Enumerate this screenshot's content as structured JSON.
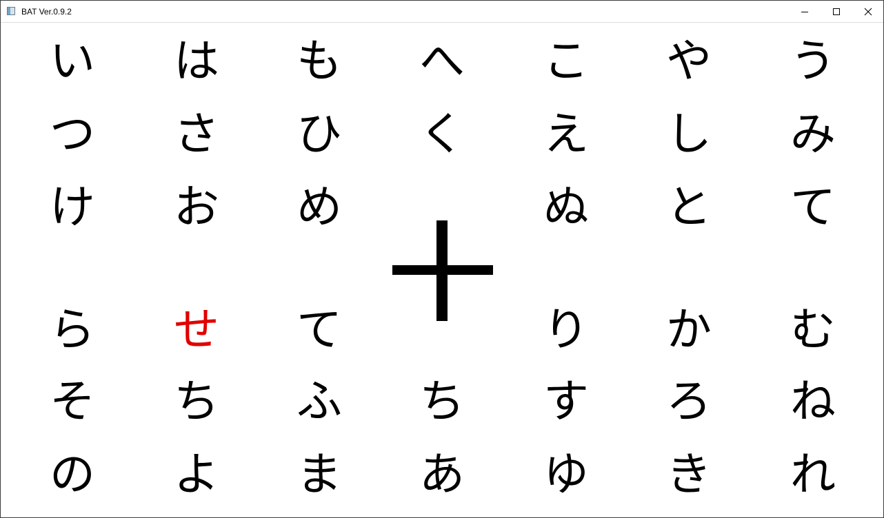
{
  "window": {
    "title": "BAT Ver.0.9.2"
  },
  "grid": {
    "rows": [
      [
        "い",
        "は",
        "も",
        "へ",
        "こ",
        "や",
        "う"
      ],
      [
        "つ",
        "さ",
        "ひ",
        "く",
        "え",
        "し",
        "み"
      ],
      [
        "け",
        "お",
        "め",
        "",
        "ぬ",
        "と",
        "て"
      ],
      [
        "ら",
        "せ",
        "て",
        "",
        "り",
        "か",
        "む"
      ],
      [
        "そ",
        "ち",
        "ふ",
        "ち",
        "す",
        "ろ",
        "ね"
      ],
      [
        "の",
        "よ",
        "ま",
        "あ",
        "ゆ",
        "き",
        "れ"
      ]
    ],
    "highlight": {
      "row": 3,
      "col": 1,
      "color": "#e00000"
    },
    "default_color": "#000000"
  },
  "fixation": {
    "symbol": "plus",
    "color": "#000000"
  }
}
